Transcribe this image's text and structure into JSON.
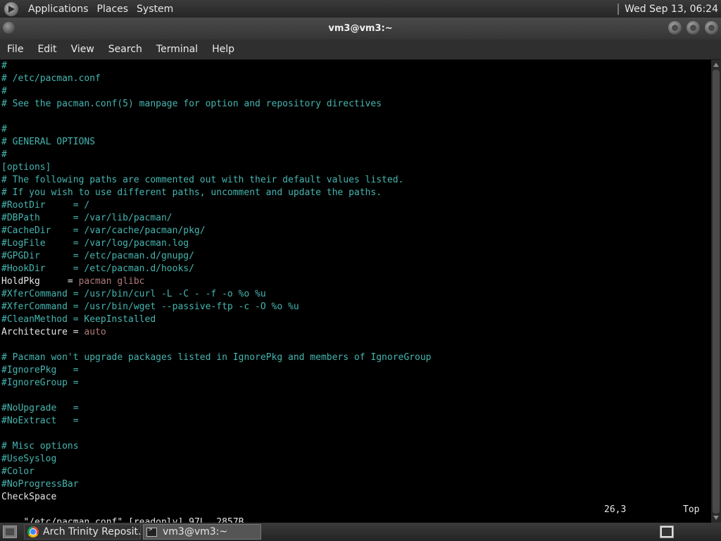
{
  "top_panel": {
    "menus": [
      "Applications",
      "Places",
      "System"
    ],
    "clock": "Wed Sep 13, 06:24"
  },
  "window": {
    "title": "vm3@vm3:~",
    "menus": [
      "File",
      "Edit",
      "View",
      "Search",
      "Terminal",
      "Help"
    ]
  },
  "terminal": {
    "lines": [
      {
        "text": "#",
        "style": "comment"
      },
      {
        "text": "# /etc/pacman.conf",
        "style": "comment"
      },
      {
        "text": "#",
        "style": "comment"
      },
      {
        "text": "# See the pacman.conf(5) manpage for option and repository directives",
        "style": "comment"
      },
      {
        "text": "",
        "style": "plain"
      },
      {
        "text": "#",
        "style": "comment"
      },
      {
        "text": "# GENERAL OPTIONS",
        "style": "comment"
      },
      {
        "text": "#",
        "style": "comment"
      },
      {
        "text": "[options]",
        "style": "comment"
      },
      {
        "text": "# The following paths are commented out with their default values listed.",
        "style": "comment"
      },
      {
        "text": "# If you wish to use different paths, uncomment and update the paths.",
        "style": "comment"
      },
      {
        "text": "#RootDir     = /",
        "style": "comment"
      },
      {
        "text": "#DBPath      = /var/lib/pacman/",
        "style": "comment"
      },
      {
        "text": "#CacheDir    = /var/cache/pacman/pkg/",
        "style": "comment"
      },
      {
        "text": "#LogFile     = /var/log/pacman.log",
        "style": "comment"
      },
      {
        "text": "#GPGDir      = /etc/pacman.d/gnupg/",
        "style": "comment"
      },
      {
        "text": "#HookDir     = /etc/pacman.d/hooks/",
        "style": "comment"
      },
      {
        "key": "HoldPkg     = ",
        "value": "pacman glibc",
        "style": "setting"
      },
      {
        "text": "#XferCommand = /usr/bin/curl -L -C - -f -o %o %u",
        "style": "comment"
      },
      {
        "text": "#XferCommand = /usr/bin/wget --passive-ftp -c -O %o %u",
        "style": "comment"
      },
      {
        "text": "#CleanMethod = KeepInstalled",
        "style": "comment"
      },
      {
        "key": "Architecture = ",
        "value": "auto",
        "style": "setting"
      },
      {
        "text": "",
        "style": "plain"
      },
      {
        "text": "# Pacman won't upgrade packages listed in IgnorePkg and members of IgnoreGroup",
        "style": "comment"
      },
      {
        "text": "#IgnorePkg   =",
        "style": "comment"
      },
      {
        "text": "#IgnoreGroup =",
        "style": "comment"
      },
      {
        "text": "",
        "style": "plain"
      },
      {
        "text": "#NoUpgrade   =",
        "style": "comment"
      },
      {
        "text": "#NoExtract   =",
        "style": "comment"
      },
      {
        "text": "",
        "style": "plain"
      },
      {
        "text": "# Misc options",
        "style": "comment"
      },
      {
        "text": "#UseSyslog",
        "style": "comment"
      },
      {
        "text": "#Color",
        "style": "comment"
      },
      {
        "text": "#NoProgressBar",
        "style": "comment"
      },
      {
        "text": "CheckSpace",
        "style": "plain"
      }
    ],
    "status": {
      "file_info": "\"/etc/pacman.conf\" [readonly] 97L, 2857B",
      "cursor": "26,3",
      "position": "Top"
    },
    "colors": {
      "comment": "#45b5b0",
      "plain": "#e6e6e6",
      "value": "#b07a7a"
    }
  },
  "taskbar": {
    "tasks": [
      {
        "label": "Arch Trinity Reposit…",
        "icon": "chrome-icon"
      },
      {
        "label": "vm3@vm3:~",
        "icon": "terminal-icon"
      }
    ]
  }
}
